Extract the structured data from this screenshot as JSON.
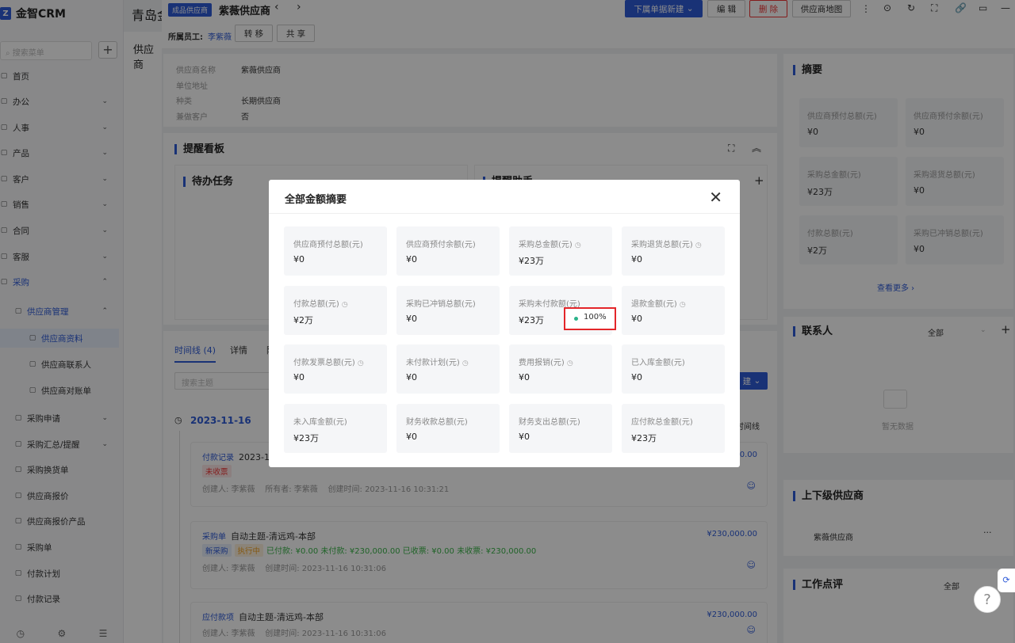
{
  "app": {
    "name": "金智CRM",
    "back_title": "青岛金",
    "back_page": "供应商"
  },
  "sidebar": {
    "search_placeholder": "搜索菜单",
    "items": [
      {
        "label": "首页",
        "icon": "grid-icon",
        "chev": ""
      },
      {
        "label": "办公",
        "icon": "briefcase-icon",
        "chev": "⌄"
      },
      {
        "label": "人事",
        "icon": "person-icon",
        "chev": "⌄"
      },
      {
        "label": "产品",
        "icon": "box-icon",
        "chev": "⌄"
      },
      {
        "label": "客户",
        "icon": "customer-icon",
        "chev": "⌄"
      },
      {
        "label": "销售",
        "icon": "sales-icon",
        "chev": "⌄"
      },
      {
        "label": "合同",
        "icon": "contract-icon",
        "chev": "⌄"
      },
      {
        "label": "客服",
        "icon": "headset-icon",
        "chev": "⌄"
      },
      {
        "label": "采购",
        "icon": "cart-icon",
        "chev": "⌃"
      },
      {
        "label": "供应商管理",
        "icon": "supplier-icon",
        "chev": "⌃"
      },
      {
        "label": "供应商资料",
        "icon": "doc-icon",
        "chev": ""
      },
      {
        "label": "供应商联系人",
        "icon": "doc-icon",
        "chev": ""
      },
      {
        "label": "供应商对账单",
        "icon": "doc-icon",
        "chev": ""
      },
      {
        "label": "采购申请",
        "icon": "request-icon",
        "chev": "⌄"
      },
      {
        "label": "采购汇总/提醒",
        "icon": "summary-icon",
        "chev": "⌄"
      },
      {
        "label": "采购换货单",
        "icon": "exchange-icon",
        "chev": ""
      },
      {
        "label": "供应商报价",
        "icon": "quote-icon",
        "chev": ""
      },
      {
        "label": "供应商报价产品",
        "icon": "quote-icon",
        "chev": ""
      },
      {
        "label": "采购单",
        "icon": "order-icon",
        "chev": ""
      },
      {
        "label": "付款计划",
        "icon": "plan-icon",
        "chev": ""
      },
      {
        "label": "付款记录",
        "icon": "record-icon",
        "chev": ""
      }
    ]
  },
  "drawer": {
    "type_badge": "成品供应商",
    "title": "紫薇供应商",
    "new_button": "下属单据新建",
    "edit_button": "编 辑",
    "delete_button": "删 除",
    "map_button": "供应商地图",
    "owner_label": "所属员工:",
    "owner_name": "李紫薇",
    "transfer_button": "转 移",
    "share_button": "共 享",
    "fields": [
      {
        "k": "供应商名称",
        "v": "紫薇供应商"
      },
      {
        "k": "单位地址",
        "v": ""
      },
      {
        "k": "种类",
        "v": "长期供应商"
      },
      {
        "k": "兼做客户",
        "v": "否"
      }
    ],
    "reminder_board": "提醒看板",
    "todo_title": "待办任务",
    "assistant_title": "提醒助手",
    "tabs": [
      "时间线 (4)",
      "详情",
      "附"
    ],
    "search_topic": "搜索主题",
    "new_small": "建",
    "timeline_label": "时间线",
    "date": "2023-11-16",
    "entries": [
      {
        "type": "付款记录",
        "title": "2023-11-",
        "tags": [
          "未收票"
        ],
        "meta": "创建人: 李紫薇    所有者: 李紫薇    创建时间: 2023-11-16 10:31:21",
        "amount": "00.00"
      },
      {
        "type": "采购单",
        "title": "自动主题-清远鸡-本部",
        "tags": [
          "新采购",
          "执行中"
        ],
        "extra": "已付款: ¥0.00    未付款: ¥230,000.00    已收票: ¥0.00    未收票: ¥230,000.00",
        "meta": "创建人: 李紫薇    创建时间: 2023-11-16 10:31:06",
        "amount": "¥230,000.00"
      },
      {
        "type": "应付款项",
        "title": "自动主题-清远鸡-本部",
        "tags": [],
        "meta": "创建人: 李紫薇    创建时间: 2023-11-16 10:31:06",
        "amount": "¥230,000.00"
      }
    ],
    "summary": {
      "title": "摘要",
      "items": [
        {
          "l": "供应商预付总额(元)",
          "v": "¥0"
        },
        {
          "l": "供应商预付余额(元)",
          "v": "¥0"
        },
        {
          "l": "采购总金额(元)",
          "v": "¥23万"
        },
        {
          "l": "采购退货总额(元)",
          "v": "¥0"
        },
        {
          "l": "付款总额(元)",
          "v": "¥2万"
        },
        {
          "l": "采购已冲销总额(元)",
          "v": "¥0"
        }
      ],
      "more": "查看更多"
    },
    "contacts": {
      "title": "联系人",
      "filter": "全部",
      "empty": "暂无数据"
    },
    "parent": {
      "title": "上下级供应商",
      "item": "紫薇供应商"
    },
    "work": {
      "title": "工作点评",
      "filter": "全部"
    }
  },
  "modal": {
    "title": "全部金额摘要",
    "items": [
      {
        "l": "供应商预付总额(元)",
        "v": "¥0",
        "clock": false
      },
      {
        "l": "供应商预付余额(元)",
        "v": "¥0",
        "clock": false
      },
      {
        "l": "采购总金额(元)",
        "v": "¥23万",
        "clock": true
      },
      {
        "l": "采购退货总额(元)",
        "v": "¥0",
        "clock": true
      },
      {
        "l": "付款总额(元)",
        "v": "¥2万",
        "clock": true
      },
      {
        "l": "采购已冲销总额(元)",
        "v": "¥0",
        "clock": false
      },
      {
        "l": "采购未付款额(元)",
        "v": "¥23万",
        "clock": false
      },
      {
        "l": "退款金额(元)",
        "v": "¥0",
        "clock": true
      },
      {
        "l": "付款发票总额(元)",
        "v": "¥0",
        "clock": true
      },
      {
        "l": "未付款计划(元)",
        "v": "¥0",
        "clock": true
      },
      {
        "l": "费用报销(元)",
        "v": "¥0",
        "clock": true
      },
      {
        "l": "已入库金额(元)",
        "v": "¥0",
        "clock": false
      },
      {
        "l": "未入库金额(元)",
        "v": "¥23万",
        "clock": false
      },
      {
        "l": "财务收款总额(元)",
        "v": "¥0",
        "clock": false
      },
      {
        "l": "财务支出总额(元)",
        "v": "¥0",
        "clock": false
      },
      {
        "l": "应付款总金额(元)",
        "v": "¥23万",
        "clock": false
      }
    ],
    "tooltip": "100%"
  },
  "colors": {
    "accent": "#2f5bd8",
    "danger": "#e3262a",
    "success": "#2bb38a",
    "warning": "#f0a020"
  }
}
